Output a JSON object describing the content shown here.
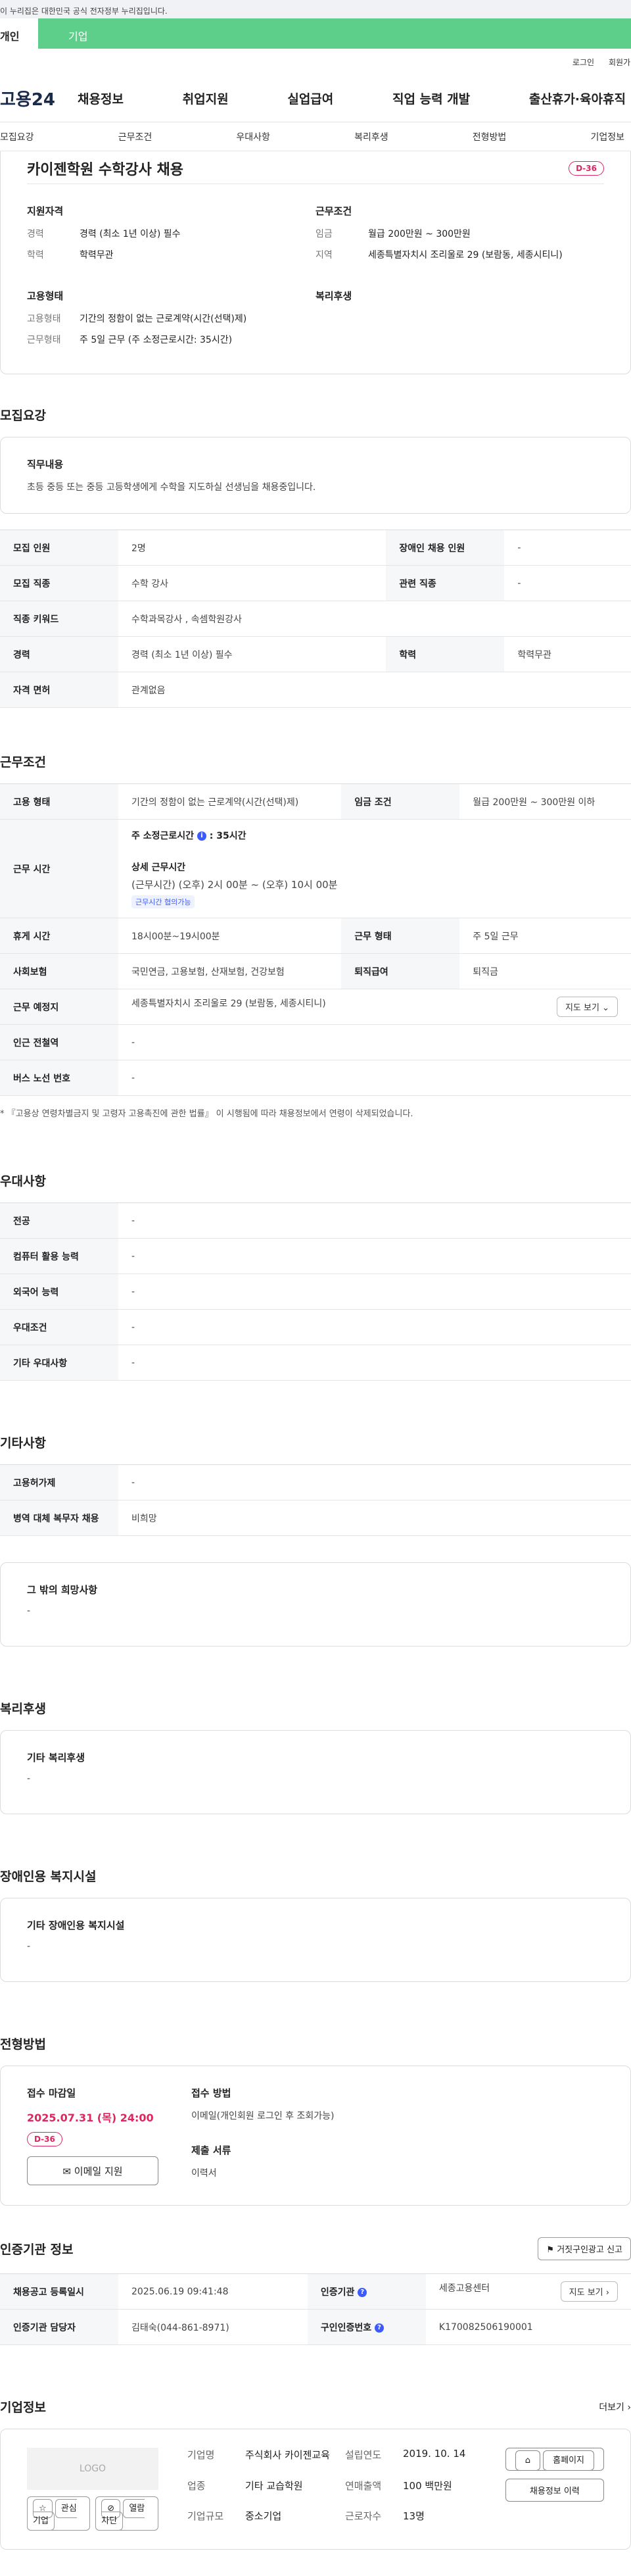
{
  "gov_banner": "이 누리집은 대한민국 공식 전자정부 누리집입니다.",
  "tabs": [
    "개인",
    "기업"
  ],
  "util": [
    "로그인",
    "회원가입"
  ],
  "logo": "고용24",
  "gnb": [
    "채용정보",
    "취업지원",
    "실업급여",
    "직업 능력 개발",
    "출산휴가·육아휴직"
  ],
  "subnav": [
    "모집요강",
    "근무조건",
    "우대사항",
    "복리후생",
    "전형방법",
    "기업정보"
  ],
  "summary": {
    "title": "카이젠학원 수학강사 채용",
    "dday": "D-36",
    "qual_title": "지원자격",
    "qual": [
      {
        "k": "경력",
        "v": "경력 (최소 1년 이상) 필수"
      },
      {
        "k": "학력",
        "v": "학력무관"
      }
    ],
    "cond_title": "근무조건",
    "cond": [
      {
        "k": "임금",
        "v": "월급 200만원 ~ 300만원"
      },
      {
        "k": "지역",
        "v": "세종특별자치시 조리울로 29 (보람동, 세종시티니)"
      }
    ],
    "emp_title": "고용형태",
    "emp": [
      {
        "k": "고용형태",
        "v": "기간의 정함이 없는 근로계약(시간(선택)제)"
      },
      {
        "k": "근무형태",
        "v": "주 5일 근무 (주 소정근로시간: 35시간)"
      }
    ],
    "welfare_title": "복리후생"
  },
  "recruit": {
    "title": "모집요강",
    "duty_title": "직무내용",
    "duty": "초등 중등  또는 중등 고등학생에게 수학을 지도하실 선생님을 채용중입니다.",
    "rows": [
      {
        "h1": "모집 인원",
        "v1": "2명",
        "h2": "장애인 채용 인원",
        "v2": "-"
      },
      {
        "h1": "모집 직종",
        "v1": "수학 강사",
        "h2": "관련 직종",
        "v2": "-"
      },
      {
        "h1": "직종 키워드",
        "v1": "수학과목강사 , 속셈학원강사"
      },
      {
        "h1": "경력",
        "v1": "경력 (최소 1년 이상) 필수",
        "h2": "학력",
        "v2": "학력무관"
      },
      {
        "h1": "자격 면허",
        "v1": "관계없음"
      }
    ]
  },
  "work": {
    "title": "근무조건",
    "emp_h": "고용 형태",
    "emp_v": "기간의 정함이 없는 근로계약(시간(선택)제)",
    "wage_h": "임금 조건",
    "wage_v": "월급 200만원 ~ 300만원 이하",
    "time_h": "근무 시간",
    "time_week": "주 소정근로시간",
    "time_week_v": ": 35시간",
    "time_detail_title": "상세 근무시간",
    "time_detail": "(근무시간) (오후) 2시 00분 ~ (오후) 10시 00분",
    "time_chip": "근무시간 협의가능",
    "break_h": "휴게 시간",
    "break_v": "18시00분~19시00분",
    "form_h": "근무 형태",
    "form_v": "주 5일 근무",
    "ins_h": "사회보험",
    "ins_v": "국민연금, 고용보험, 산재보험, 건강보험",
    "ret_h": "퇴직급여",
    "ret_v": "퇴직금",
    "place_h": "근무 예정지",
    "place_v": "세종특별자치시 조리울로 29 (보람동, 세종시티니)",
    "map_btn": "지도 보기",
    "sub_h": "인근 전철역",
    "sub_v": "-",
    "bus_h": "버스 노선 번호",
    "bus_v": "-",
    "note": "* 『고용상 연령차별금지 및 고령자 고용촉진에 관한 법률』 이 시행됨에 따라 채용정보에서 연령이 삭제되었습니다."
  },
  "pref": {
    "title": "우대사항",
    "rows": [
      {
        "h": "전공",
        "v": "-"
      },
      {
        "h": "컴퓨터 활용 능력",
        "v": "-"
      },
      {
        "h": "외국어 능력",
        "v": "-"
      },
      {
        "h": "우대조건",
        "v": "-"
      },
      {
        "h": "기타 우대사항",
        "v": "-"
      }
    ]
  },
  "etc": {
    "title": "기타사항",
    "rows": [
      {
        "h": "고용허가제",
        "v": "-"
      },
      {
        "h": "병역 대체 복무자 채용",
        "v": "비희망"
      }
    ],
    "box_title": "그 밖의 희망사항",
    "box_v": "-"
  },
  "welfare": {
    "title": "복리후생",
    "box_title": "기타 복리후생",
    "box_v": "-"
  },
  "disabled": {
    "title": "장애인용 복지시설",
    "box_title": "기타 장애인용 복지시설",
    "box_v": "-"
  },
  "apply": {
    "title": "전형방법",
    "deadline_title": "접수 마감일",
    "deadline": "2025.07.31 (목) 24:00",
    "dday": "D-36",
    "email_btn": "이메일 지원",
    "method_title": "접수 방법",
    "method": "이메일(개인회원 로그인 후 조회가능)",
    "docs_title": "제출 서류",
    "docs": "이력서"
  },
  "agency": {
    "title": "인증기관 정보",
    "flag_btn": "거짓구인광고 신고",
    "r1h1": "채용공고 등록일시",
    "r1v1": "2025.06.19 09:41:48",
    "r1h2": "인증기관",
    "r1v2": "세종고용센터",
    "map_btn": "지도 보기",
    "r2h1": "인증기관 담당자",
    "r2v1": "김태숙(044-861-8971)",
    "r2h2": "구인인증번호",
    "r2v2": "K170082506190001"
  },
  "company": {
    "title": "기업정보",
    "more": "더보기",
    "logo": "LOGO",
    "fav": "관심기업",
    "block": "열람차단",
    "name_k": "기업명",
    "name_v": "주식회사 카이젠교육",
    "year_k": "설립연도",
    "year_v": "2019. 10. 14",
    "ind_k": "업종",
    "ind_v": "기타 교습학원",
    "sales_k": "연매출액",
    "sales_v": "100 백만원",
    "size_k": "기업규모",
    "size_v": "중소기업",
    "emp_k": "근로자수",
    "emp_v": "13명",
    "home_btn": "홈페이지",
    "jobs_btn": "채용정보 이력"
  }
}
